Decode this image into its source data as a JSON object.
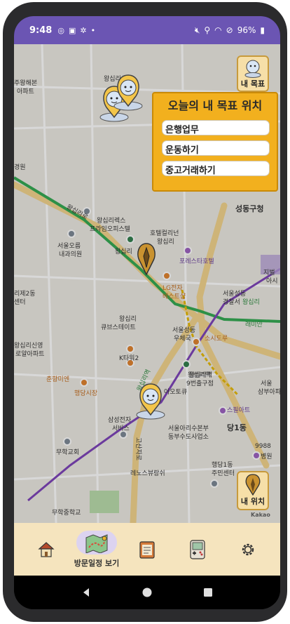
{
  "status_bar": {
    "time": "9:48",
    "battery": "96%"
  },
  "map": {
    "labels": [
      {
        "text": "왕십리상당"
      },
      {
        "text": "주왕해본"
      },
      {
        "text": "아파트"
      },
      {
        "text": "경원"
      },
      {
        "text": "왕십리렉스"
      },
      {
        "text": "프라임오피스텔"
      },
      {
        "text": "호텔컬리넌"
      },
      {
        "text": "왕십리"
      },
      {
        "text": "서울오름"
      },
      {
        "text": "내과의원"
      },
      {
        "text": "왕십리"
      },
      {
        "text": "포레스타호텔"
      },
      {
        "text": "LG전자"
      },
      {
        "text": "베스트샵"
      },
      {
        "text": "서울성동"
      },
      {
        "text": "경찰서"
      },
      {
        "text": "지벌"
      },
      {
        "text": "아시"
      },
      {
        "text": "성동구청"
      },
      {
        "text": "래미안"
      },
      {
        "text": "리제2동"
      },
      {
        "text": "센터"
      },
      {
        "text": "왕십리"
      },
      {
        "text": "큐브스테이트"
      },
      {
        "text": "서울성동"
      },
      {
        "text": "우체국"
      },
      {
        "text": "소시도루"
      },
      {
        "text": "왕십리역"
      },
      {
        "text": "왕십리신영"
      },
      {
        "text": "로얄아파트"
      },
      {
        "text": "K타워2"
      },
      {
        "text": "왕십리역"
      },
      {
        "text": "9번출구점"
      },
      {
        "text": "춘향미엔"
      },
      {
        "text": "행당시장"
      },
      {
        "text": "아오토큐"
      },
      {
        "text": "서울"
      },
      {
        "text": "삼부아파"
      },
      {
        "text": "삼성전자"
      },
      {
        "text": "서비스"
      },
      {
        "text": "스필아트"
      },
      {
        "text": "서울아리수본부"
      },
      {
        "text": "동부수도사업소"
      },
      {
        "text": "당1동"
      },
      {
        "text": "무학교회"
      },
      {
        "text": "레노스뷰랑쉬"
      },
      {
        "text": "행당1동"
      },
      {
        "text": "주민센터"
      },
      {
        "text": "9988"
      },
      {
        "text": "병원"
      },
      {
        "text": "무학중학교"
      },
      {
        "text": "왕십리로"
      },
      {
        "text": "고산자로"
      },
      {
        "text": "왕십리"
      },
      {
        "text": "왕십리역"
      }
    ]
  },
  "goal_panel": {
    "title": "오늘의 내 목표 위치",
    "items": [
      "은행업무",
      "운동하기",
      "중고거래하기"
    ]
  },
  "buttons": {
    "my_goal": "내 목표",
    "my_location": "내 위치",
    "map_provider": "Kakao"
  },
  "bottom_nav": {
    "items": [
      {
        "icon": "house-icon",
        "label": ""
      },
      {
        "icon": "map-route-icon",
        "label": "방문일정 보기"
      },
      {
        "icon": "schedule-board-icon",
        "label": ""
      },
      {
        "icon": "game-console-icon",
        "label": ""
      },
      {
        "icon": "gear-icon",
        "label": ""
      }
    ]
  },
  "colors": {
    "status_bar": "#6b55b3",
    "goal_panel": "#f2b01e",
    "bottom_nav": "#f5e4be",
    "active_nav_bubble": "#dcd3f0",
    "subway_green": "#2fa84f",
    "subway_purple": "#7b3fb8",
    "subway_yellow": "#e6b800"
  }
}
